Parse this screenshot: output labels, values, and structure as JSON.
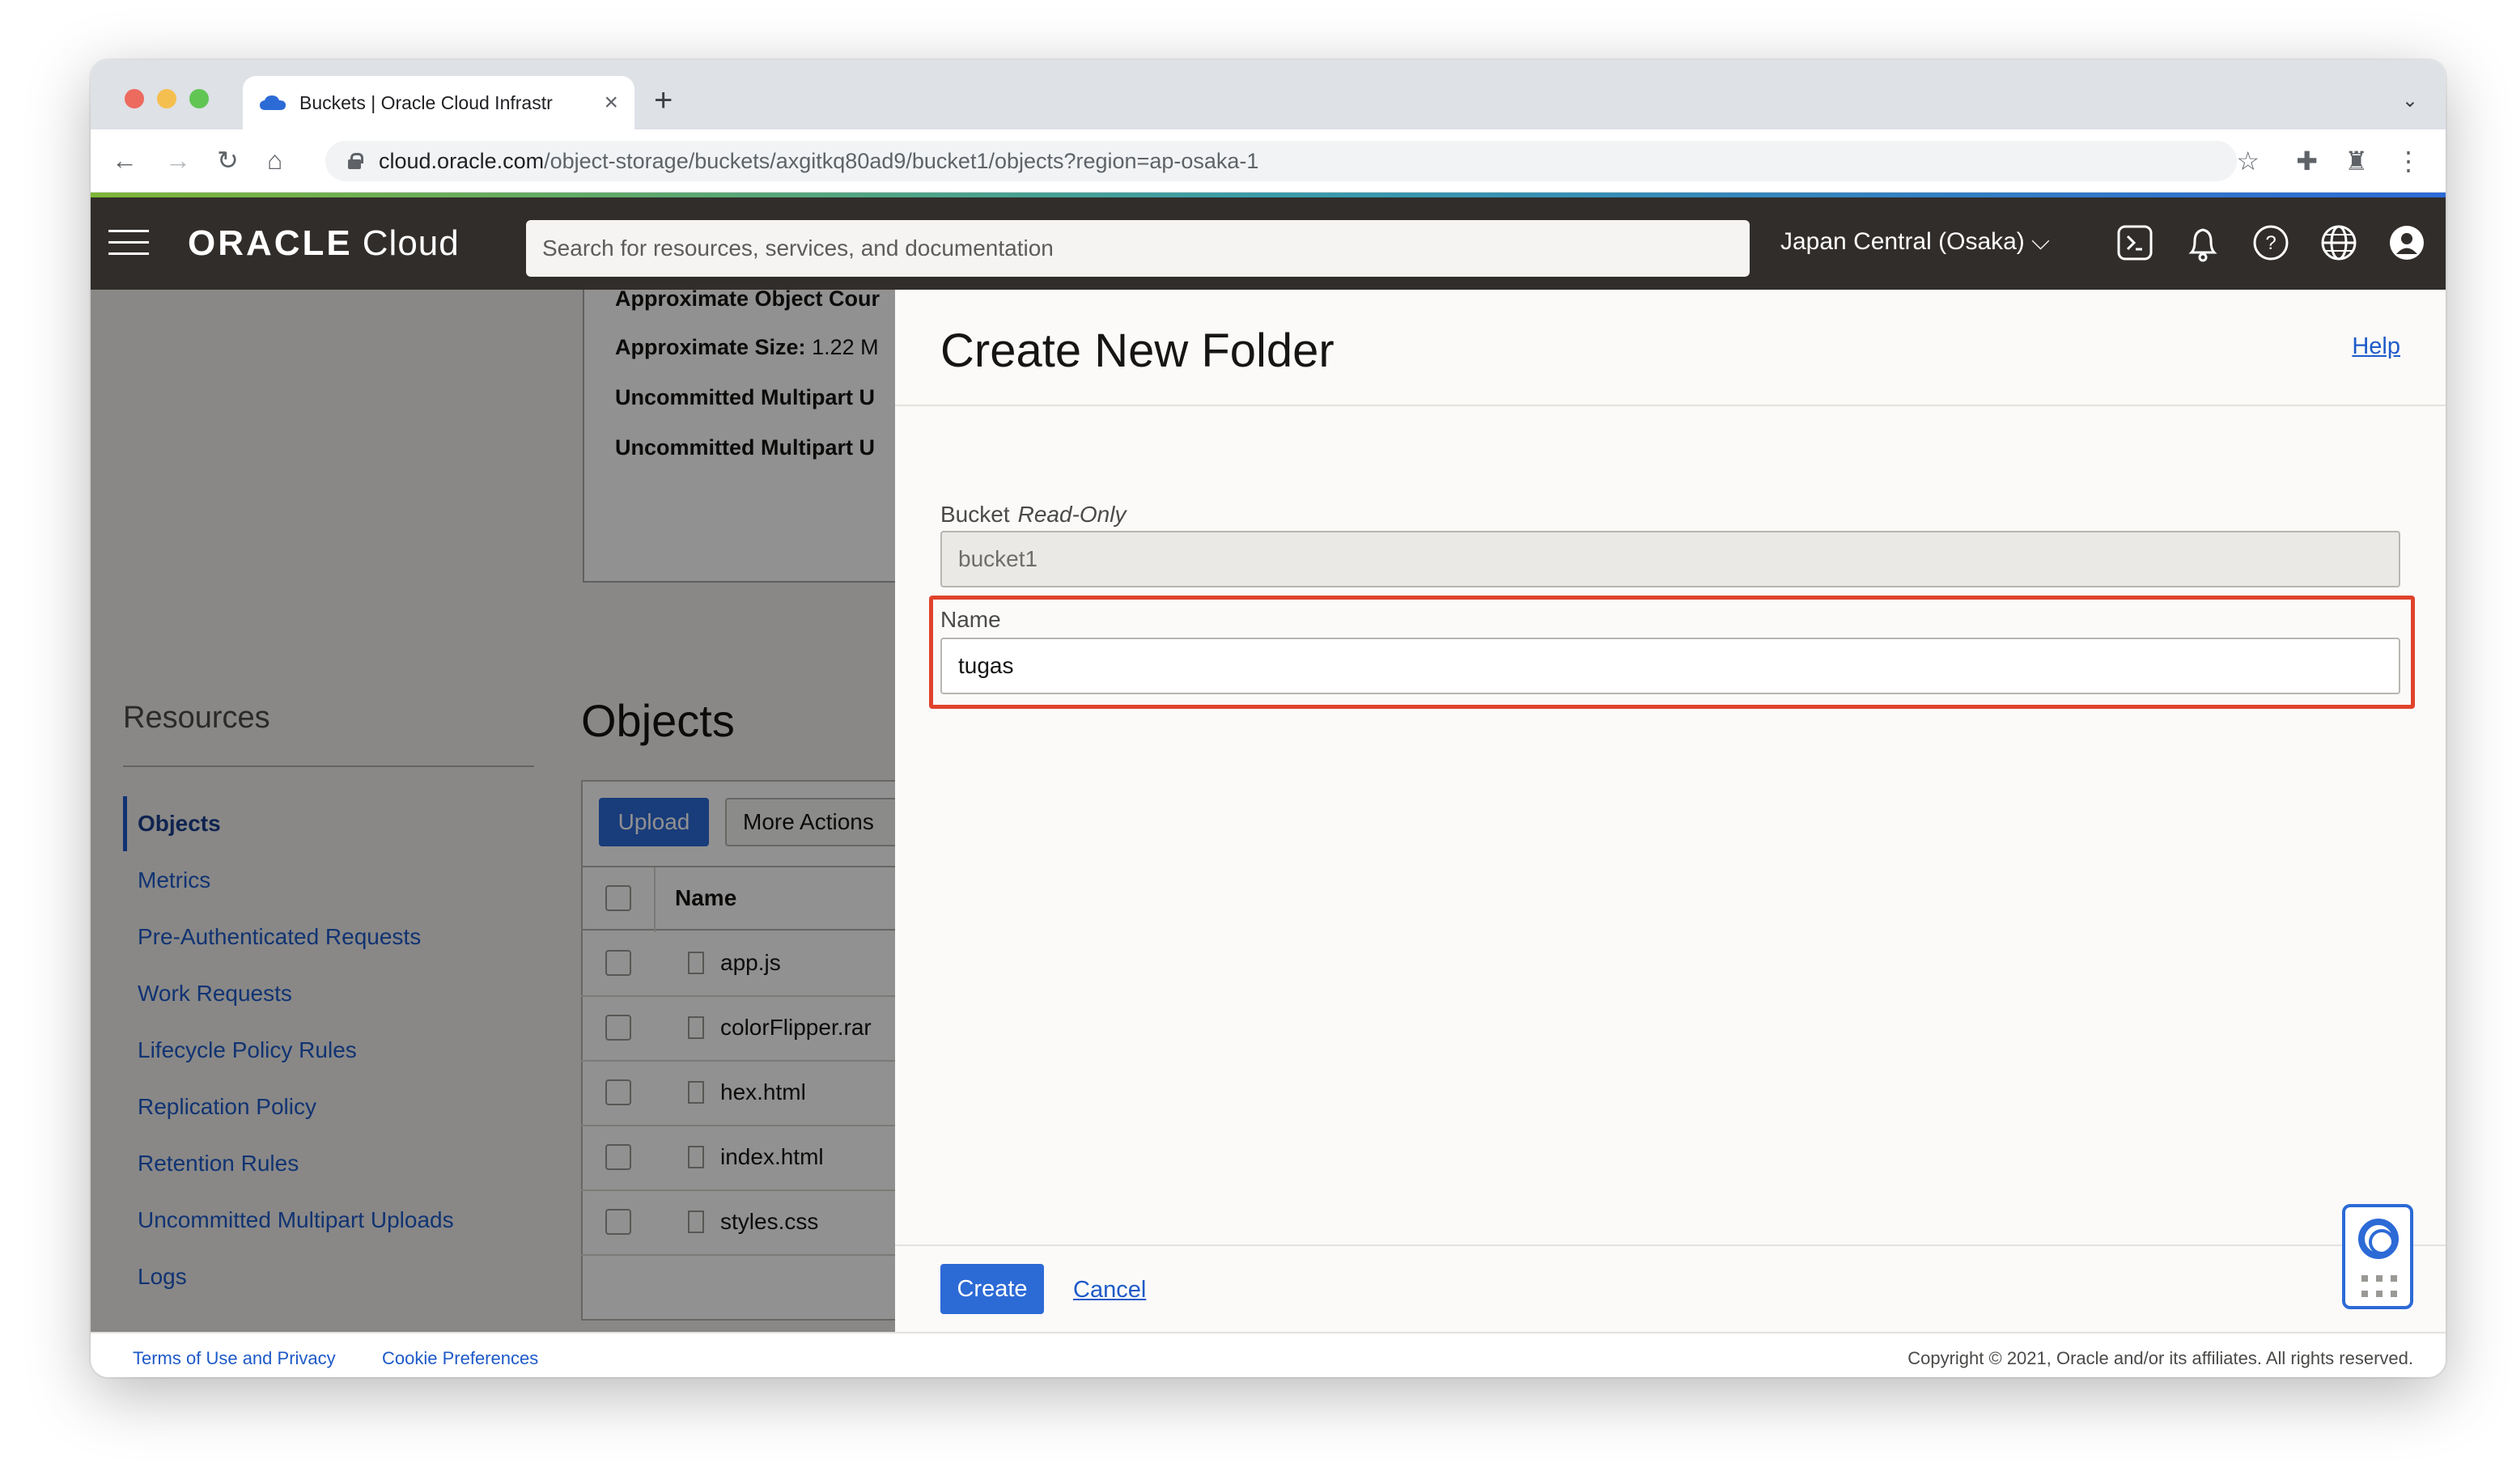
{
  "browser": {
    "tab_title": "Buckets | Oracle Cloud Infrastr",
    "url_host": "cloud.oracle.com",
    "url_path": "/object-storage/buckets/axgitkq80ad9/bucket1/objects?region=ap-osaka-1"
  },
  "header": {
    "brand_bold": "ORACLE",
    "brand_light": "Cloud",
    "search_placeholder": "Search for resources, services, and documentation",
    "region": "Japan Central (Osaka)"
  },
  "details": {
    "object_count_label": "Approximate Object Cour",
    "size_label": "Approximate Size:",
    "size_value": "1.22 M",
    "uncommitted_1": "Uncommitted Multipart U",
    "uncommitted_2": "Uncommitted Multipart U"
  },
  "resources": {
    "heading": "Resources",
    "items": [
      {
        "label": "Objects"
      },
      {
        "label": "Metrics"
      },
      {
        "label": "Pre-Authenticated Requests"
      },
      {
        "label": "Work Requests"
      },
      {
        "label": "Lifecycle Policy Rules"
      },
      {
        "label": "Replication Policy"
      },
      {
        "label": "Retention Rules"
      },
      {
        "label": "Uncommitted Multipart Uploads"
      },
      {
        "label": "Logs"
      }
    ]
  },
  "objects": {
    "heading": "Objects",
    "upload_label": "Upload",
    "more_actions_label": "More Actions",
    "name_header": "Name",
    "files": [
      {
        "name": "app.js"
      },
      {
        "name": "colorFlipper.rar"
      },
      {
        "name": "hex.html"
      },
      {
        "name": "index.html"
      },
      {
        "name": "styles.css"
      }
    ]
  },
  "panel": {
    "title": "Create New Folder",
    "help_label": "Help",
    "bucket_label": "Bucket",
    "bucket_readonly_label": "Read-Only",
    "bucket_value": "bucket1",
    "name_label": "Name",
    "name_value": "tugas",
    "create_label": "Create",
    "cancel_label": "Cancel"
  },
  "footer": {
    "terms": "Terms of Use and Privacy",
    "cookies": "Cookie Preferences",
    "copyright": "Copyright © 2021, Oracle and/or its affiliates. All rights reserved."
  },
  "colors": {
    "header_bg": "#312d2a",
    "accent_blue": "#2c6ad6",
    "link_blue": "#1e5ac8",
    "highlight_red": "#e0432c"
  }
}
